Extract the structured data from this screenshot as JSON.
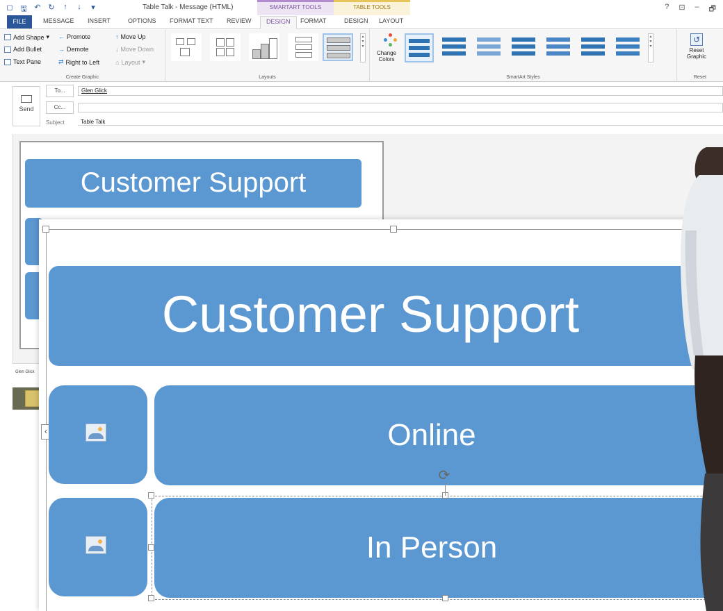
{
  "titlebar": {
    "quick_access": [
      "save-icon",
      "undo-icon",
      "redo-icon",
      "up-icon",
      "down-icon",
      "more-icon"
    ],
    "window_title": "Table Talk - Message (HTML)",
    "context_smartart": "SMARTART TOOLS",
    "context_table": "TABLE TOOLS",
    "controls": [
      "?",
      "⊡",
      "–",
      "🗗"
    ]
  },
  "tabs": {
    "file": "FILE",
    "message": "MESSAGE",
    "insert": "INSERT",
    "options": "OPTIONS",
    "format_text": "FORMAT TEXT",
    "review": "REVIEW",
    "design": "DESIGN",
    "format": "FORMAT",
    "table_design": "DESIGN",
    "layout": "LAYOUT"
  },
  "ribbon": {
    "create_graphic": {
      "add_shape": "Add Shape",
      "add_bullet": "Add Bullet",
      "text_pane": "Text Pane",
      "promote": "Promote",
      "demote": "Demote",
      "right_to_left": "Right to Left",
      "move_up": "Move Up",
      "move_down": "Move Down",
      "layout": "Layout",
      "group_label": "Create Graphic"
    },
    "layouts_label": "Layouts",
    "change_colors_line1": "Change",
    "change_colors_line2": "Colors",
    "styles_label": "SmartArt Styles",
    "reset_line1": "Reset",
    "reset_line2": "Graphic",
    "reset_group": "Reset"
  },
  "message": {
    "send": "Send",
    "to_button": "To...",
    "to_value": "Glen Glick",
    "cc_button": "Cc...",
    "cc_value": "",
    "subject_label": "Subject",
    "subject_value": "Table Talk"
  },
  "small_smartart": {
    "title": "Customer Support"
  },
  "status": {
    "person_name": "Glen Glick"
  },
  "zoomed_smartart": {
    "title": "Customer Support",
    "rows": [
      {
        "label": "Online"
      },
      {
        "label": "In Person"
      }
    ]
  },
  "colors": {
    "smartart_blue": "#5b97d0",
    "file_tab": "#2b579a",
    "context_smartart": "#b28bcf",
    "context_table": "#e8c55a"
  }
}
